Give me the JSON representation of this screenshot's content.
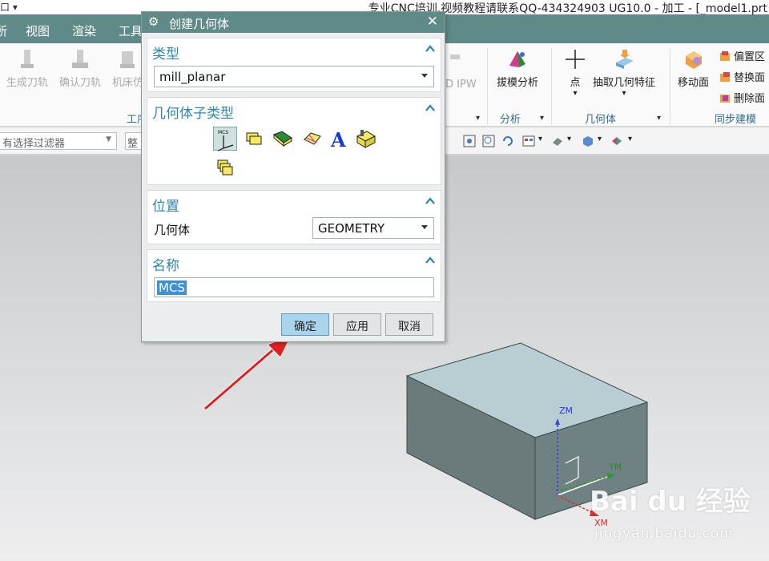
{
  "window": {
    "quick_access": "口 ▾",
    "title": "专业CNC培训.视频教程请联系QQ-434324903 UG10.0 - 加工 - [_model1.prt"
  },
  "menu": [
    "所",
    "视图",
    "渲染",
    "工具"
  ],
  "ribbon": {
    "left_buttons": [
      "生成刀轨",
      "确认刀轨",
      "机床仿"
    ],
    "left_group_label": "工序",
    "ipw_label": "D IPW",
    "analysis_button": "拔模分析",
    "analysis_group": "分析",
    "point_button": "点",
    "extract_button": "抽取几何特征",
    "geometry_group": "几何体",
    "move_face_button": "移动面",
    "small_items": [
      "偏置区",
      "替换面",
      "删除面"
    ],
    "sync_group": "同步建模"
  },
  "filterbar": {
    "filter_value": "有选择过滤器",
    "scope_value": "整"
  },
  "dialog": {
    "title": "创建几何体",
    "type_section": "类型",
    "type_value": "mill_planar",
    "subtype_section": "几何体子类型",
    "subtypes": [
      "MCS",
      "WORKPIECE",
      "MILL_AREA",
      "MILL_BND",
      "MILL_TEXT",
      "MILL_GEOM",
      "MILL_NESTED"
    ],
    "selected_subtype": "MCS",
    "location_section": "位置",
    "geometry_label": "几何体",
    "geometry_value": "GEOMETRY",
    "name_section": "名称",
    "name_value": "MCS",
    "ok": "确定",
    "apply": "应用",
    "cancel": "取消"
  },
  "viewport": {
    "axis_zm": "ZM",
    "axis_ym": "YM",
    "axis_xm": "XM"
  },
  "watermark": {
    "logo": "Bai du 经验",
    "url": "jingyan.baidu.com"
  },
  "colors": {
    "accent": "#5f8a87",
    "section_title": "#2f86b0",
    "ok_button": "#a9d4ec",
    "arrow": "#e02020"
  }
}
